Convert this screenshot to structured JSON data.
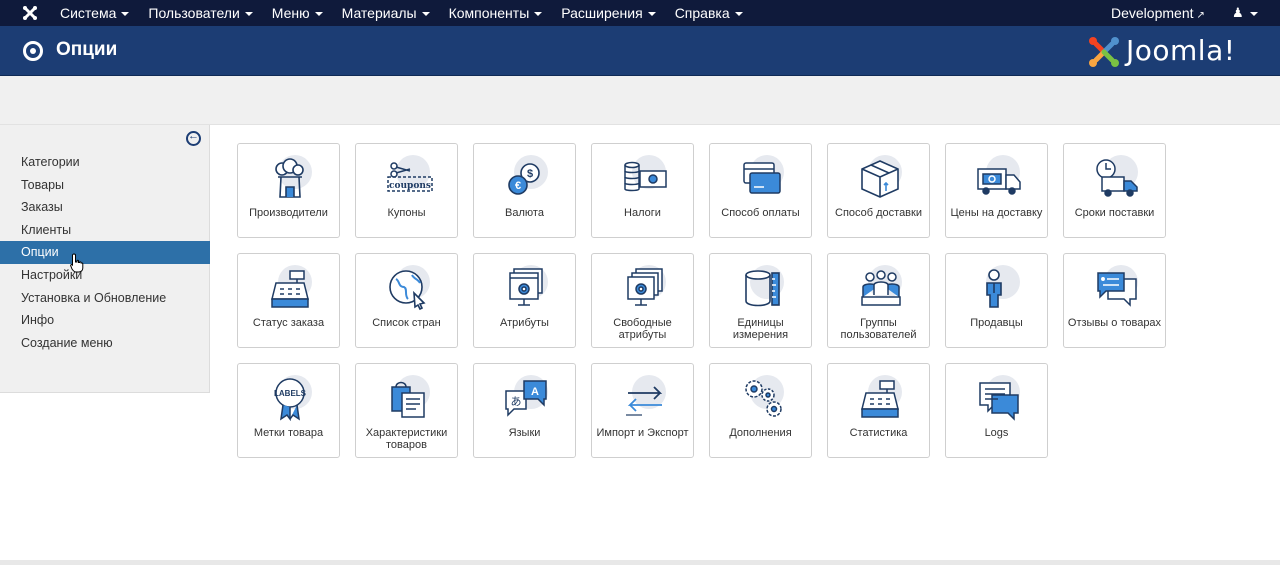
{
  "topbar": {
    "menu": [
      "Система",
      "Пользователи",
      "Меню",
      "Материалы",
      "Компоненты",
      "Расширения",
      "Справка"
    ],
    "dev_label": "Development",
    "user_icon": "user-icon"
  },
  "header": {
    "title": "Опции",
    "logo_text": "Joomla!"
  },
  "sidebar": {
    "items": [
      "Категории",
      "Товары",
      "Заказы",
      "Клиенты",
      "Опции",
      "Настройки",
      "Установка и Обновление",
      "Инфо",
      "Создание меню"
    ],
    "active": "Опции"
  },
  "tiles": [
    {
      "label": "Производители",
      "icon": "factory-icon"
    },
    {
      "label": "Купоны",
      "icon": "coupon-icon"
    },
    {
      "label": "Валюта",
      "icon": "currency-icon"
    },
    {
      "label": "Налоги",
      "icon": "tax-icon"
    },
    {
      "label": "Способ оплаты",
      "icon": "payment-card-icon"
    },
    {
      "label": "Способ доставки",
      "icon": "delivery-box-icon"
    },
    {
      "label": "Цены на доставку",
      "icon": "delivery-truck-price-icon"
    },
    {
      "label": "Сроки поставки",
      "icon": "delivery-time-icon"
    },
    {
      "label": "Статус заказа",
      "icon": "cash-register-icon"
    },
    {
      "label": "Список стран",
      "icon": "globe-icon"
    },
    {
      "label": "Атрибуты",
      "icon": "attributes-icon"
    },
    {
      "label": "Свободные атрибуты",
      "icon": "free-attributes-icon"
    },
    {
      "label": "Единицы измерения",
      "icon": "measure-units-icon"
    },
    {
      "label": "Группы пользователей",
      "icon": "user-groups-icon"
    },
    {
      "label": "Продавцы",
      "icon": "seller-icon"
    },
    {
      "label": "Отзывы о товарах",
      "icon": "reviews-icon"
    },
    {
      "label": "Метки товара",
      "icon": "labels-icon"
    },
    {
      "label": "Характеристики товаров",
      "icon": "product-features-icon"
    },
    {
      "label": "Языки",
      "icon": "languages-icon"
    },
    {
      "label": "Импорт и Экспорт",
      "icon": "import-export-icon"
    },
    {
      "label": "Дополнения",
      "icon": "addons-gears-icon"
    },
    {
      "label": "Статистика",
      "icon": "statistics-icon"
    },
    {
      "label": "Logs",
      "icon": "logs-icon"
    }
  ],
  "icon_text": {
    "coupons": "coupons",
    "labels": "LABELS",
    "lang_a": "A",
    "lang_b": "あ"
  },
  "colors": {
    "navbar": "#0f1a3b",
    "header": "#1c3d74",
    "active": "#2d70a8",
    "icon_blue": "#3b8ad9"
  }
}
